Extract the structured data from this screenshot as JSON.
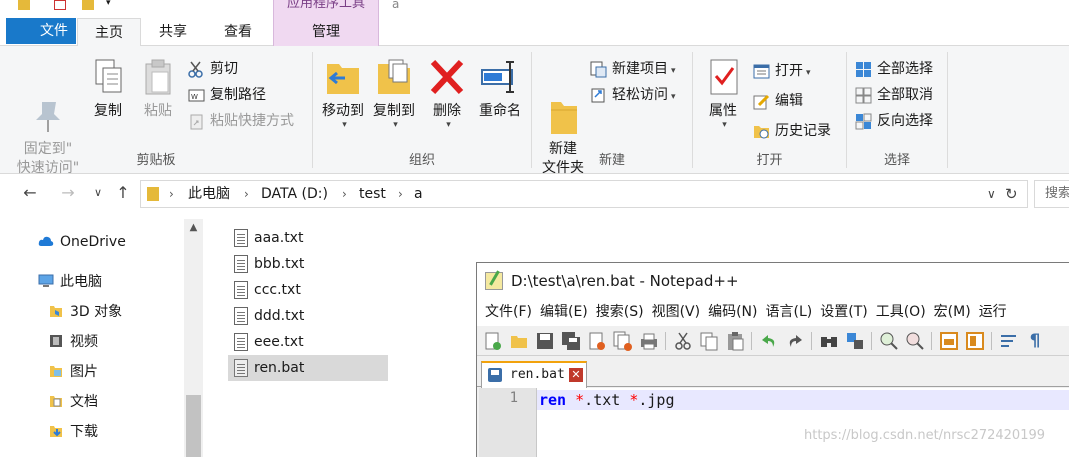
{
  "ribbon_tabs": {
    "context_header": "应用程序工具",
    "context_folder": "a",
    "file": "文件",
    "home": "主页",
    "share": "共享",
    "view": "查看",
    "manage": "管理"
  },
  "clipboard": {
    "group": "剪贴板",
    "pin": "固定到\"\n快速访问\"",
    "copy": "复制",
    "paste": "粘贴",
    "cut": "剪切",
    "copy_path": "复制路径",
    "paste_shortcut": "粘贴快捷方式"
  },
  "organize": {
    "group": "组织",
    "move_to": "移动到",
    "copy_to": "复制到",
    "delete": "删除",
    "rename": "重命名"
  },
  "new": {
    "group": "新建",
    "new_folder": "新建\n文件夹",
    "new_item": "新建项目",
    "easy_access": "轻松访问"
  },
  "open": {
    "group": "打开",
    "properties": "属性",
    "open": "打开",
    "edit": "编辑",
    "history": "历史记录"
  },
  "select": {
    "group": "选择",
    "select_all": "全部选择",
    "select_none": "全部取消",
    "invert": "反向选择"
  },
  "address": {
    "crumbs": [
      "此电脑",
      "DATA (D:)",
      "test",
      "a"
    ],
    "search_placeholder": "搜索\"a\""
  },
  "nav": {
    "items": [
      "OneDrive",
      "此电脑",
      "3D 对象",
      "视频",
      "图片",
      "文档",
      "下载"
    ]
  },
  "files": [
    "aaa.txt",
    "bbb.txt",
    "ccc.txt",
    "ddd.txt",
    "eee.txt",
    "ren.bat"
  ],
  "notepad": {
    "title": "D:\\test\\a\\ren.bat - Notepad++",
    "menu": [
      "文件(F)",
      "编辑(E)",
      "搜索(S)",
      "视图(V)",
      "编码(N)",
      "语言(L)",
      "设置(T)",
      "工具(O)",
      "宏(M)",
      "运行"
    ],
    "tab": "ren.bat",
    "line_number": "1",
    "code_keyword": "ren",
    "code_rest": " *.txt *.jpg"
  },
  "watermark": "https://blog.csdn.net/nrsc272420199"
}
